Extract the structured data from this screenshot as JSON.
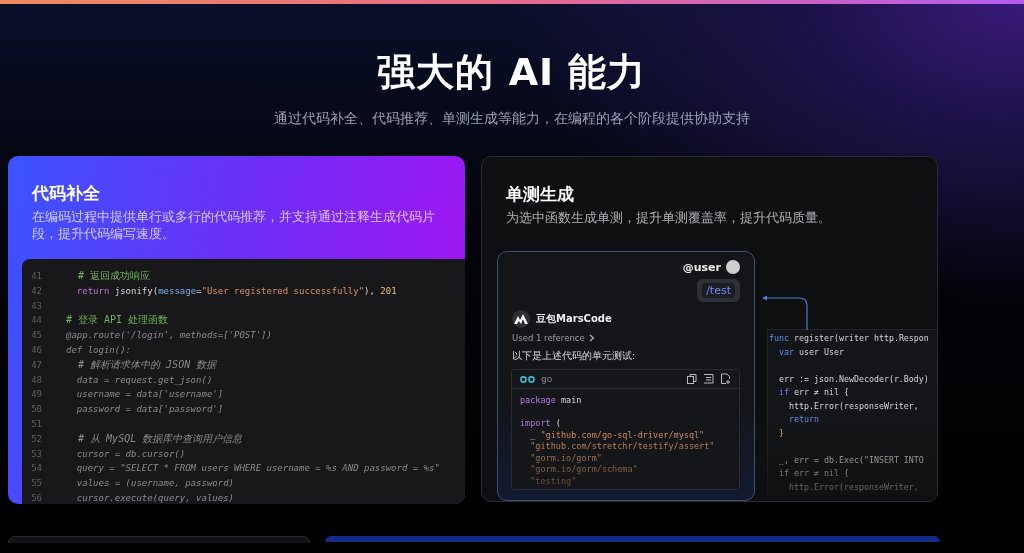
{
  "header": {
    "title": "强大的 AI 能力",
    "subtitle": "通过代码补全、代码推荐、单测生成等能力，在编程的各个阶段提供协助支持"
  },
  "cards": [
    {
      "kind": "completion",
      "title": "代码补全",
      "description": "在编码过程中提供单行或多行的代码推荐，并支持通过注释生成代码片段，提升代码编写速度。",
      "code": [
        {
          "number": "41",
          "tokens": [
            {
              "kind": "comment",
              "text": "  # 返回成功响应"
            }
          ]
        },
        {
          "number": "42",
          "tokens": [
            {
              "kind": "keyword",
              "text": "  return"
            },
            {
              "kind": "plain",
              "text": " jsonify("
            },
            {
              "kind": "param",
              "text": "message"
            },
            {
              "kind": "plain",
              "text": "="
            },
            {
              "kind": "string",
              "text": "\"User registered successfully\""
            },
            {
              "kind": "plain",
              "text": "), "
            },
            {
              "kind": "number",
              "text": "201"
            }
          ]
        },
        {
          "number": "43"
        },
        {
          "number": "44",
          "tokens": [
            {
              "kind": "comment",
              "text": "# 登录 API 处理函数"
            }
          ]
        },
        {
          "number": "45",
          "tokens": [
            {
              "kind": "dim",
              "text": "@app.route('/login', methods=['POST'])"
            }
          ]
        },
        {
          "number": "46",
          "tokens": [
            {
              "kind": "dim",
              "text": "def login():"
            }
          ]
        },
        {
          "number": "47",
          "tokens": [
            {
              "kind": "dimcomment",
              "text": "  # 解析请求体中的 JSON 数据"
            }
          ]
        },
        {
          "number": "48",
          "tokens": [
            {
              "kind": "dim",
              "text": "  data = request.get_json()"
            }
          ]
        },
        {
          "number": "49",
          "tokens": [
            {
              "kind": "dim",
              "text": "  username = data['username']"
            }
          ]
        },
        {
          "number": "50",
          "tokens": [
            {
              "kind": "dim",
              "text": "  password = data['password']"
            }
          ]
        },
        {
          "number": "51"
        },
        {
          "number": "52",
          "tokens": [
            {
              "kind": "dimcomment",
              "text": "  # 从 MySQL 数据库中查询用户信息"
            }
          ]
        },
        {
          "number": "53",
          "tokens": [
            {
              "kind": "dim",
              "text": "  cursor = db.cursor()"
            }
          ]
        },
        {
          "number": "54",
          "tokens": [
            {
              "kind": "dim",
              "text": "  query = \"SELECT * FROM users WHERE username = %s AND password = %s\""
            }
          ]
        },
        {
          "number": "55",
          "tokens": [
            {
              "kind": "dim",
              "text": "  values = (username, password)"
            }
          ]
        },
        {
          "number": "56",
          "tokens": [
            {
              "kind": "dim",
              "text": "  cursor.execute(query, values)"
            }
          ]
        }
      ]
    },
    {
      "kind": "unittest",
      "title": "单测生成",
      "description": "为选中函数生成单测，提升单测覆盖率，提升代码质量。",
      "chat": {
        "user": "@user",
        "command": "/test",
        "assistant": "豆包MarsCode",
        "reference": "Used 1 reference",
        "intro": "以下是上述代码的单元测试:",
        "language": "go",
        "code": [
          {
            "kind": "code",
            "tokens": [
              {
                "kind": "keyword",
                "text": "package"
              },
              {
                "kind": "plain",
                "text": " main"
              }
            ]
          },
          {
            "kind": "blank"
          },
          {
            "kind": "code",
            "tokens": [
              {
                "kind": "keyword",
                "text": "import"
              },
              {
                "kind": "plain",
                "text": " ("
              }
            ]
          },
          {
            "kind": "code",
            "tokens": [
              {
                "kind": "plain",
                "text": "  _ "
              },
              {
                "kind": "string",
                "text": "\"github.com/go-sql-driver/mysql\""
              }
            ]
          },
          {
            "kind": "code",
            "tokens": [
              {
                "kind": "string",
                "text": "  \"github.com/stretchr/testify/assert\""
              }
            ]
          },
          {
            "kind": "code",
            "tokens": [
              {
                "kind": "string",
                "text": "  \"gorm.io/gorm\""
              }
            ]
          },
          {
            "kind": "code",
            "tokens": [
              {
                "kind": "string",
                "text": "  \"gorm.io/gorm/schema\""
              }
            ]
          },
          {
            "kind": "code",
            "tokens": [
              {
                "kind": "string",
                "text": "  \"testing\""
              }
            ]
          }
        ]
      },
      "source": [
        {
          "kind": "code",
          "tokens": [
            {
              "kind": "keyword",
              "text": "func"
            },
            {
              "kind": "plain",
              "text": " register(writer http.Respon"
            }
          ]
        },
        {
          "kind": "code",
          "tokens": [
            {
              "kind": "keyword",
              "text": "  var"
            },
            {
              "kind": "plain",
              "text": " user User"
            }
          ]
        },
        {
          "kind": "blank"
        },
        {
          "kind": "code",
          "tokens": [
            {
              "kind": "plain",
              "text": "  err := json.NewDecoder(r.Body)"
            }
          ]
        },
        {
          "kind": "code",
          "tokens": [
            {
              "kind": "keyword",
              "text": "  if"
            },
            {
              "kind": "plain",
              "text": " err ≠ nil {"
            }
          ]
        },
        {
          "kind": "code",
          "tokens": [
            {
              "kind": "plain",
              "text": "    http.Error(responseWriter,"
            }
          ]
        },
        {
          "kind": "code",
          "tokens": [
            {
              "kind": "keyword",
              "text": "    return"
            }
          ]
        },
        {
          "kind": "code",
          "tokens": [
            {
              "kind": "number",
              "text": "  }"
            }
          ]
        },
        {
          "kind": "blank"
        },
        {
          "kind": "code",
          "tokens": [
            {
              "kind": "plain",
              "text": "  _, err = db.Exec(\"INSERT INTO"
            }
          ]
        },
        {
          "kind": "code",
          "tokens": [
            {
              "kind": "plain",
              "text": "  if err ≠ nil {"
            }
          ]
        },
        {
          "kind": "code",
          "tokens": [
            {
              "kind": "plain",
              "text": "    http.Error(responseWriter,"
            }
          ]
        }
      ]
    }
  ]
}
